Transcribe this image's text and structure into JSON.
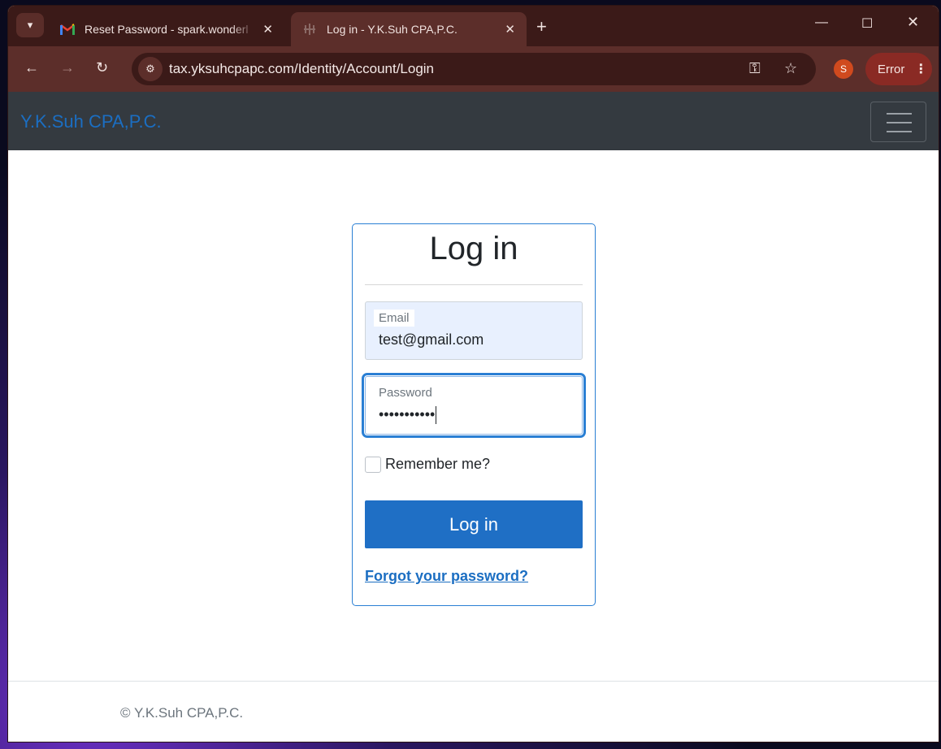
{
  "browser": {
    "tabs": [
      {
        "title": "Reset Password - spark.wonderl",
        "favicon": "gmail-icon",
        "active": false
      },
      {
        "title": "Log in - Y.K.Suh CPA,P.C.",
        "favicon": "site-icon",
        "active": true
      }
    ],
    "url": "tax.yksuhcpapc.com/Identity/Account/Login",
    "profile_initial": "S",
    "error_label": "Error"
  },
  "site": {
    "brand": "Y.K.Suh CPA,P.C."
  },
  "login": {
    "heading": "Log in",
    "email_label": "Email",
    "email_value": "test@gmail.com",
    "password_label": "Password",
    "password_value": "•••••••••••",
    "remember_label": "Remember me?",
    "submit_label": "Log in",
    "forgot_label": "Forgot your password?"
  },
  "footer": {
    "text": "© Y.K.Suh CPA,P.C."
  },
  "colors": {
    "accent": "#1b6ec2",
    "button": "#1f6fc5",
    "navbar": "#343a40",
    "chrome_frame": "#3b1a18"
  }
}
